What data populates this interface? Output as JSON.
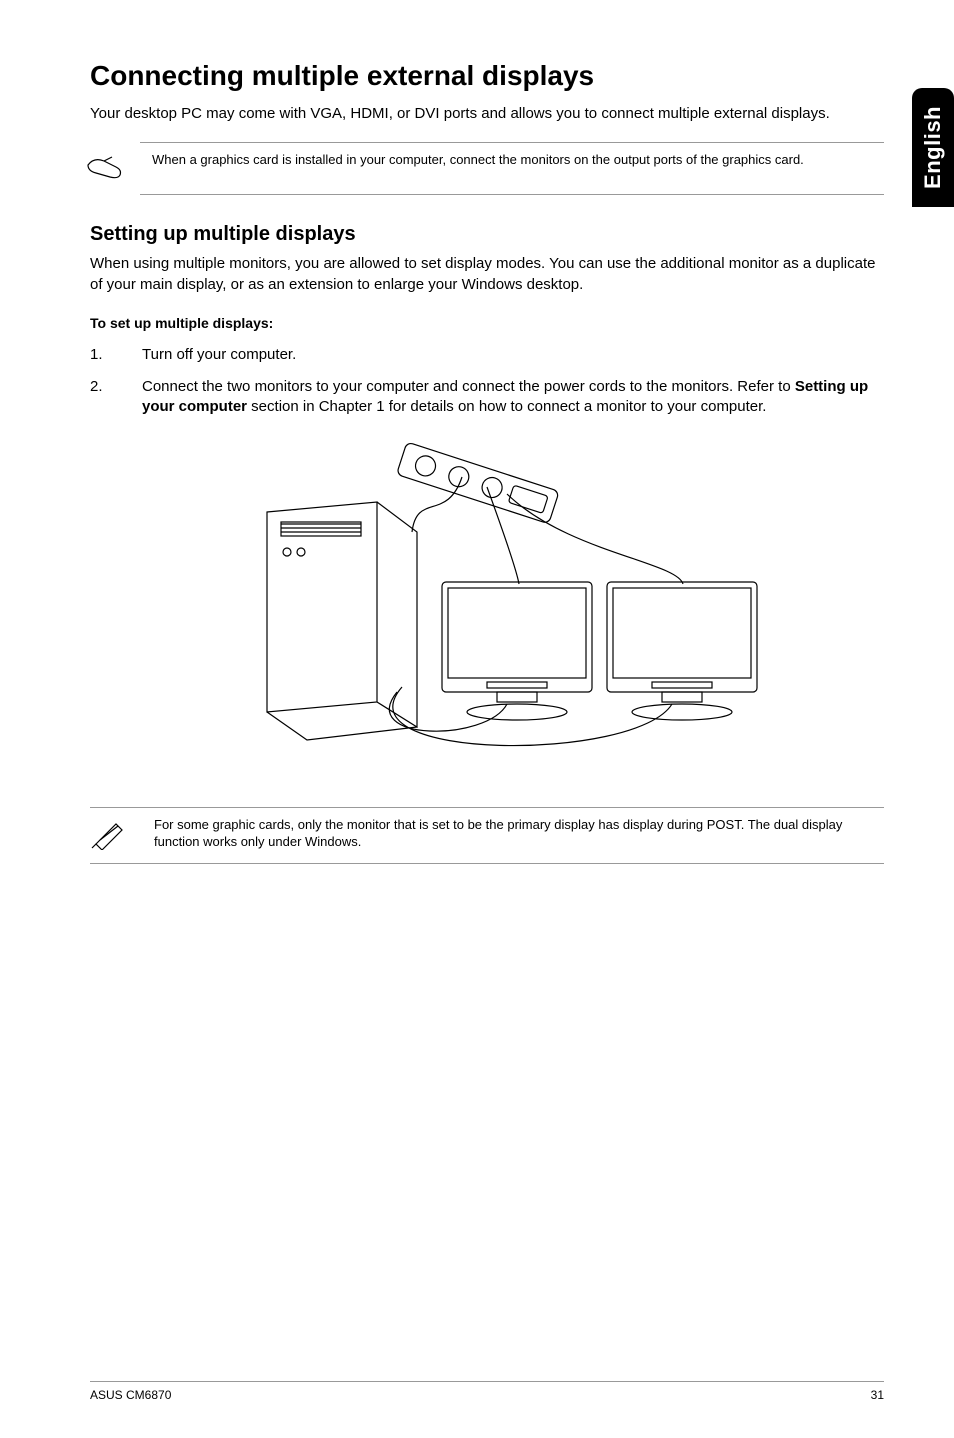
{
  "sideTab": "English",
  "title": "Connecting multiple external displays",
  "intro": "Your desktop PC may come with VGA, HDMI, or DVI ports and allows you to connect multiple external displays.",
  "note1": "When a graphics card is installed in your computer, connect the monitors on the output ports of the graphics card.",
  "subheading": "Setting up multiple displays",
  "subpara": "When using multiple monitors, you are allowed to set display modes. You can use the additional monitor as a duplicate of your main display, or as an extension to enlarge your Windows desktop.",
  "stepsHeading": "To set up multiple displays:",
  "steps": [
    {
      "num": "1.",
      "text": "Turn off your computer."
    },
    {
      "num": "2.",
      "before": "Connect the two monitors to your computer and connect the power cords to the monitors. Refer to ",
      "bold": "Setting up your computer",
      "after": " section in Chapter 1 for details on how to connect a monitor to your computer."
    }
  ],
  "note2": "For some graphic cards, only the monitor that is set to be the primary display has display during POST. The dual display function works only under Windows.",
  "footerLeft": "ASUS CM6870",
  "footerRight": "31"
}
